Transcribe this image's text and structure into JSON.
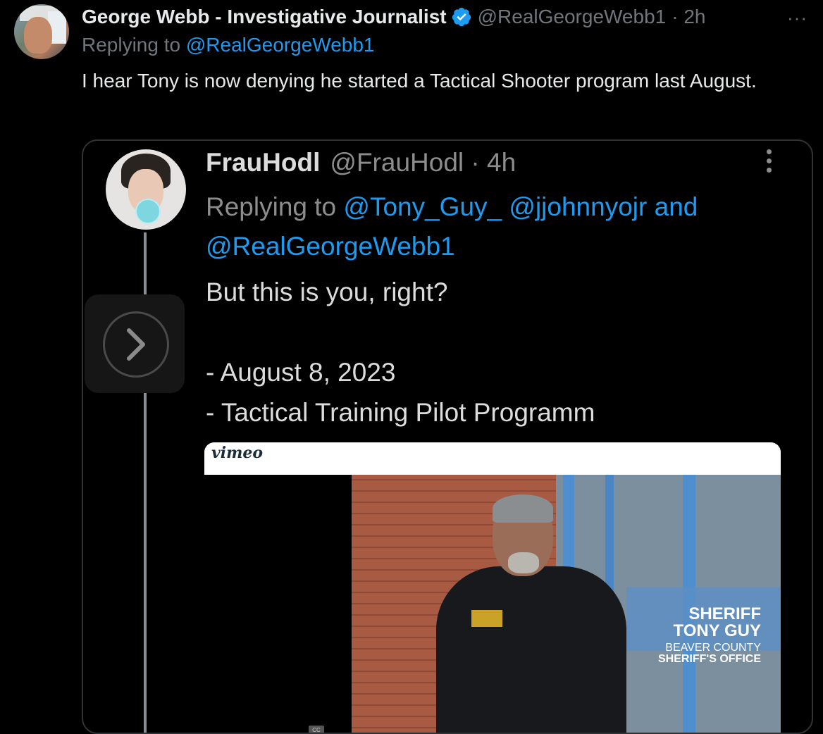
{
  "tweet": {
    "author_name": "George Webb - Investigative Journalist",
    "handle": "@RealGeorgeWebb1",
    "time": "· 2h",
    "more": "···",
    "replying_prefix": "Replying to ",
    "replying_to": "@RealGeorgeWebb1",
    "text": "I hear Tony is now denying he started a Tactical Shooter program last August.",
    "verified_color": "#1d9bf0"
  },
  "quoted": {
    "author_name": "FrauHodl",
    "handle_time": "@FrauHodl · 4h",
    "replying_prefix": "Replying to ",
    "mention1": "@Tony_Guy_",
    "mention2": "@jjohnnyojr",
    "and": " and",
    "mention3": "@RealGeorgeWebb1",
    "line1": "But this is you, right?",
    "line2": "- August 8, 2023",
    "line3": "- Tactical Training Pilot Programm"
  },
  "video": {
    "logo": "vimeo",
    "caption_title": "SHERIFF",
    "caption_name": "TONY GUY",
    "caption_org1": "BEAVER COUNTY",
    "caption_org2": "SHERIFF'S OFFICE",
    "cc": "CC"
  }
}
